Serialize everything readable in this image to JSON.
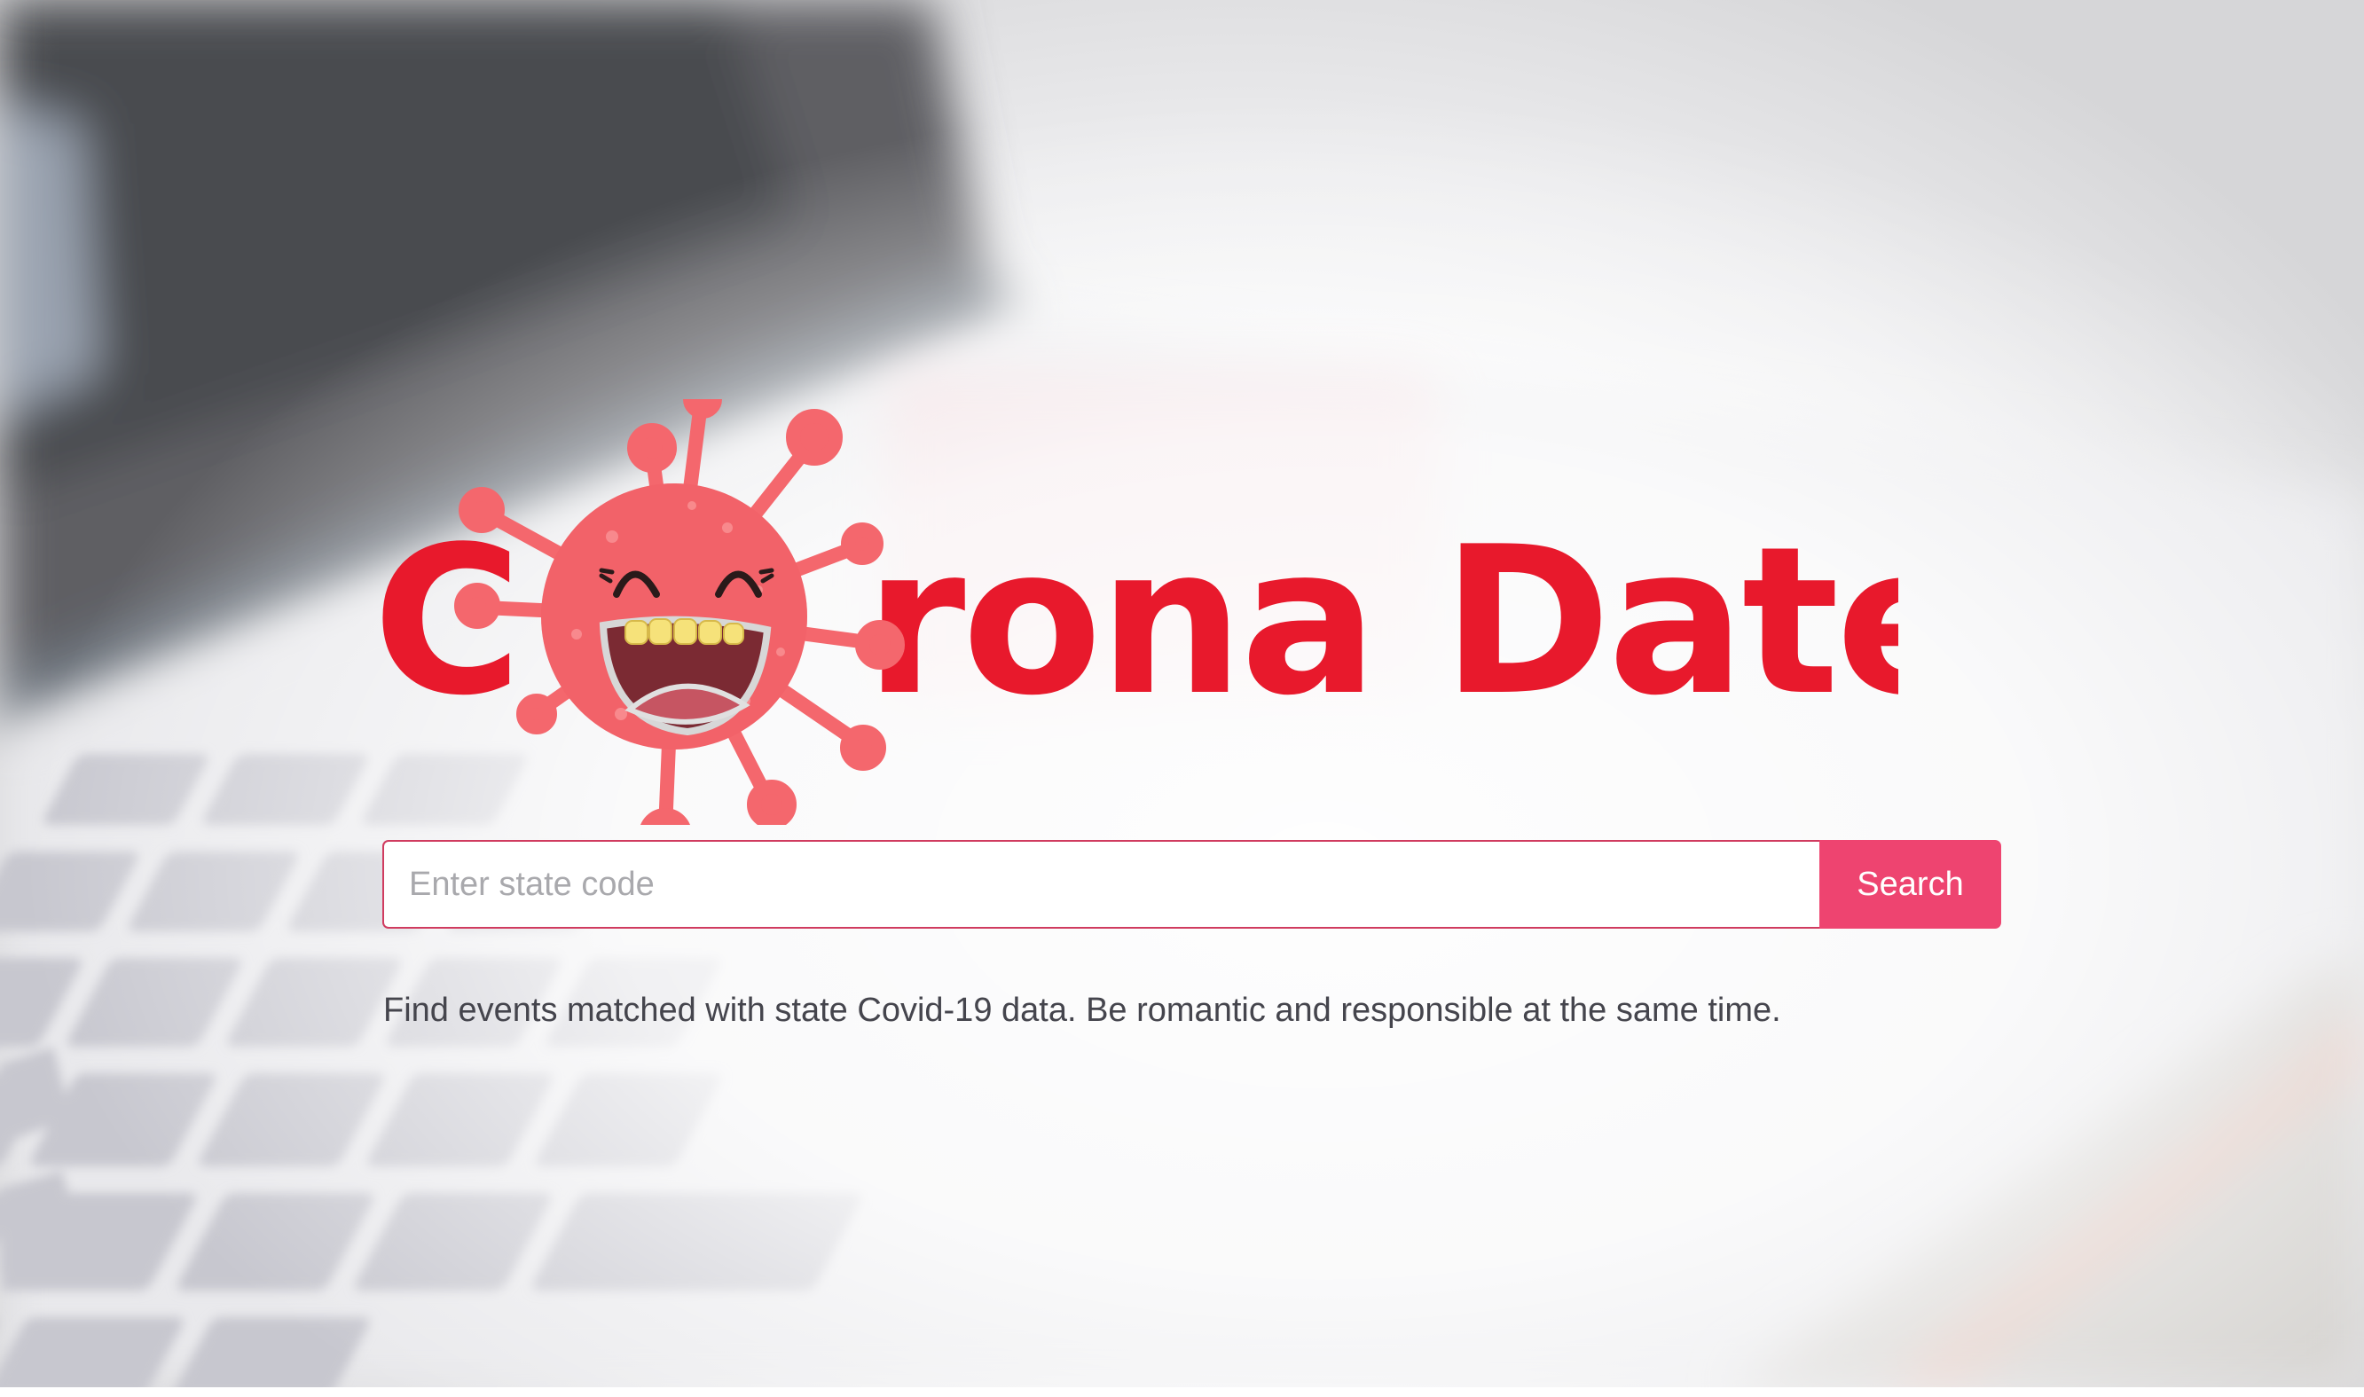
{
  "brand": {
    "logo_text_prefix": "C",
    "logo_text_rest": "rona Date",
    "mascot_icon": "smiling-virus-mascot-icon",
    "brand_color": "#e8192c",
    "mascot_color": "#f4676d"
  },
  "search": {
    "placeholder": "Enter state code",
    "value": "",
    "button_label": "Search",
    "button_color": "#ee4470",
    "border_color": "#d03b5f"
  },
  "tagline": "Find events matched with state Covid-19 data. Be romantic and responsible at the same time.",
  "background": {
    "image": "blurred-laptop-keyboard-photo"
  }
}
